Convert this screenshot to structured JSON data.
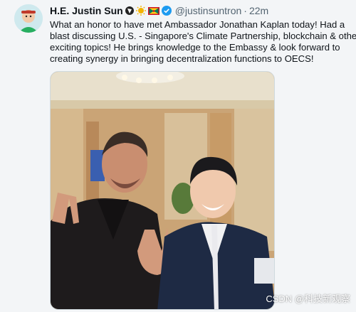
{
  "tweet": {
    "display_name": "H.E. Justin Sun",
    "handle": "@justinsuntron",
    "separator": "·",
    "time": "22m",
    "text_lines": [
      "What an honor to have met Ambassador Jonathan Kaplan today! Had a",
      "blast discussing U.S. - Singapore's Climate Partnership, blockchain & other",
      "exciting topics! He brings knowledge to the Embassy & look forward to",
      "creating synergy in bringing decentralization functions to OECS!"
    ],
    "icons": [
      "avatar",
      "tron-badge-icon",
      "sun-emoji-icon",
      "grenada-flag-icon",
      "verified-badge-icon"
    ],
    "colors": {
      "verified": "#1d9bf0",
      "link_gray": "#536471"
    }
  },
  "photo": {
    "subject": "photo"
  },
  "watermark": "CSDN @科技新观察"
}
